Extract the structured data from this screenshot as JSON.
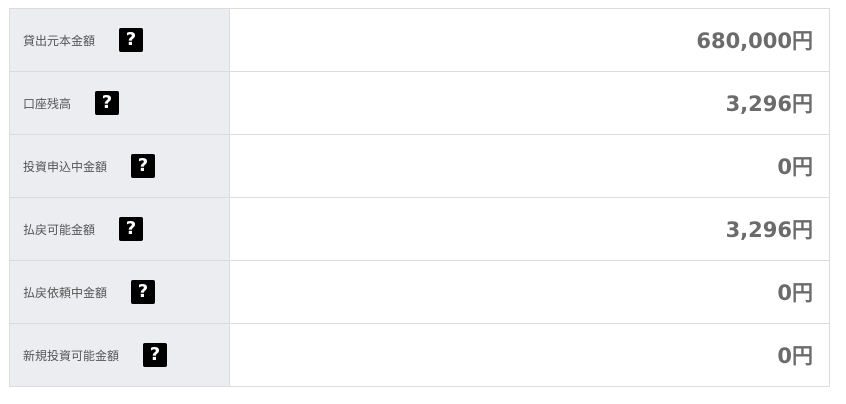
{
  "rows": [
    {
      "label": "貸出元本金額",
      "help_icon": "?",
      "value": "680,000円"
    },
    {
      "label": "口座残高",
      "help_icon": "?",
      "value": "3,296円"
    },
    {
      "label": "投資申込中金額",
      "help_icon": "?",
      "value": "0円"
    },
    {
      "label": "払戻可能金額",
      "help_icon": "?",
      "value": "3,296円"
    },
    {
      "label": "払戻依頼中金額",
      "help_icon": "?",
      "value": "0円"
    },
    {
      "label": "新規投資可能金額",
      "help_icon": "?",
      "value": "0円"
    }
  ],
  "colors": {
    "label_bg": "#ecedf1",
    "border": "#dcdcdc",
    "value_text": "#6b6b6b",
    "icon_bg": "#000000"
  }
}
